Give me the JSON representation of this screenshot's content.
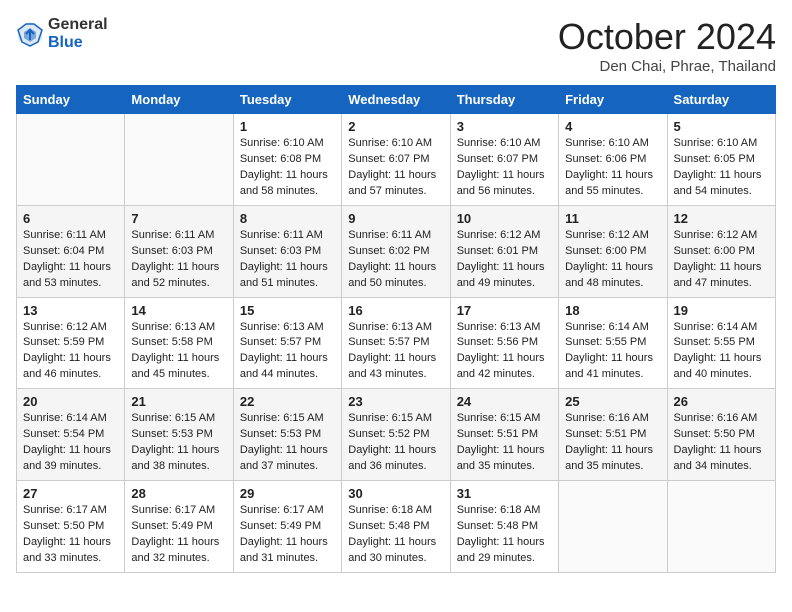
{
  "header": {
    "logo_general": "General",
    "logo_blue": "Blue",
    "month_title": "October 2024",
    "location": "Den Chai, Phrae, Thailand"
  },
  "weekdays": [
    "Sunday",
    "Monday",
    "Tuesday",
    "Wednesday",
    "Thursday",
    "Friday",
    "Saturday"
  ],
  "weeks": [
    [
      {
        "day": "",
        "sunrise": "",
        "sunset": "",
        "daylight": ""
      },
      {
        "day": "",
        "sunrise": "",
        "sunset": "",
        "daylight": ""
      },
      {
        "day": "1",
        "sunrise": "Sunrise: 6:10 AM",
        "sunset": "Sunset: 6:08 PM",
        "daylight": "Daylight: 11 hours and 58 minutes."
      },
      {
        "day": "2",
        "sunrise": "Sunrise: 6:10 AM",
        "sunset": "Sunset: 6:07 PM",
        "daylight": "Daylight: 11 hours and 57 minutes."
      },
      {
        "day": "3",
        "sunrise": "Sunrise: 6:10 AM",
        "sunset": "Sunset: 6:07 PM",
        "daylight": "Daylight: 11 hours and 56 minutes."
      },
      {
        "day": "4",
        "sunrise": "Sunrise: 6:10 AM",
        "sunset": "Sunset: 6:06 PM",
        "daylight": "Daylight: 11 hours and 55 minutes."
      },
      {
        "day": "5",
        "sunrise": "Sunrise: 6:10 AM",
        "sunset": "Sunset: 6:05 PM",
        "daylight": "Daylight: 11 hours and 54 minutes."
      }
    ],
    [
      {
        "day": "6",
        "sunrise": "Sunrise: 6:11 AM",
        "sunset": "Sunset: 6:04 PM",
        "daylight": "Daylight: 11 hours and 53 minutes."
      },
      {
        "day": "7",
        "sunrise": "Sunrise: 6:11 AM",
        "sunset": "Sunset: 6:03 PM",
        "daylight": "Daylight: 11 hours and 52 minutes."
      },
      {
        "day": "8",
        "sunrise": "Sunrise: 6:11 AM",
        "sunset": "Sunset: 6:03 PM",
        "daylight": "Daylight: 11 hours and 51 minutes."
      },
      {
        "day": "9",
        "sunrise": "Sunrise: 6:11 AM",
        "sunset": "Sunset: 6:02 PM",
        "daylight": "Daylight: 11 hours and 50 minutes."
      },
      {
        "day": "10",
        "sunrise": "Sunrise: 6:12 AM",
        "sunset": "Sunset: 6:01 PM",
        "daylight": "Daylight: 11 hours and 49 minutes."
      },
      {
        "day": "11",
        "sunrise": "Sunrise: 6:12 AM",
        "sunset": "Sunset: 6:00 PM",
        "daylight": "Daylight: 11 hours and 48 minutes."
      },
      {
        "day": "12",
        "sunrise": "Sunrise: 6:12 AM",
        "sunset": "Sunset: 6:00 PM",
        "daylight": "Daylight: 11 hours and 47 minutes."
      }
    ],
    [
      {
        "day": "13",
        "sunrise": "Sunrise: 6:12 AM",
        "sunset": "Sunset: 5:59 PM",
        "daylight": "Daylight: 11 hours and 46 minutes."
      },
      {
        "day": "14",
        "sunrise": "Sunrise: 6:13 AM",
        "sunset": "Sunset: 5:58 PM",
        "daylight": "Daylight: 11 hours and 45 minutes."
      },
      {
        "day": "15",
        "sunrise": "Sunrise: 6:13 AM",
        "sunset": "Sunset: 5:57 PM",
        "daylight": "Daylight: 11 hours and 44 minutes."
      },
      {
        "day": "16",
        "sunrise": "Sunrise: 6:13 AM",
        "sunset": "Sunset: 5:57 PM",
        "daylight": "Daylight: 11 hours and 43 minutes."
      },
      {
        "day": "17",
        "sunrise": "Sunrise: 6:13 AM",
        "sunset": "Sunset: 5:56 PM",
        "daylight": "Daylight: 11 hours and 42 minutes."
      },
      {
        "day": "18",
        "sunrise": "Sunrise: 6:14 AM",
        "sunset": "Sunset: 5:55 PM",
        "daylight": "Daylight: 11 hours and 41 minutes."
      },
      {
        "day": "19",
        "sunrise": "Sunrise: 6:14 AM",
        "sunset": "Sunset: 5:55 PM",
        "daylight": "Daylight: 11 hours and 40 minutes."
      }
    ],
    [
      {
        "day": "20",
        "sunrise": "Sunrise: 6:14 AM",
        "sunset": "Sunset: 5:54 PM",
        "daylight": "Daylight: 11 hours and 39 minutes."
      },
      {
        "day": "21",
        "sunrise": "Sunrise: 6:15 AM",
        "sunset": "Sunset: 5:53 PM",
        "daylight": "Daylight: 11 hours and 38 minutes."
      },
      {
        "day": "22",
        "sunrise": "Sunrise: 6:15 AM",
        "sunset": "Sunset: 5:53 PM",
        "daylight": "Daylight: 11 hours and 37 minutes."
      },
      {
        "day": "23",
        "sunrise": "Sunrise: 6:15 AM",
        "sunset": "Sunset: 5:52 PM",
        "daylight": "Daylight: 11 hours and 36 minutes."
      },
      {
        "day": "24",
        "sunrise": "Sunrise: 6:15 AM",
        "sunset": "Sunset: 5:51 PM",
        "daylight": "Daylight: 11 hours and 35 minutes."
      },
      {
        "day": "25",
        "sunrise": "Sunrise: 6:16 AM",
        "sunset": "Sunset: 5:51 PM",
        "daylight": "Daylight: 11 hours and 35 minutes."
      },
      {
        "day": "26",
        "sunrise": "Sunrise: 6:16 AM",
        "sunset": "Sunset: 5:50 PM",
        "daylight": "Daylight: 11 hours and 34 minutes."
      }
    ],
    [
      {
        "day": "27",
        "sunrise": "Sunrise: 6:17 AM",
        "sunset": "Sunset: 5:50 PM",
        "daylight": "Daylight: 11 hours and 33 minutes."
      },
      {
        "day": "28",
        "sunrise": "Sunrise: 6:17 AM",
        "sunset": "Sunset: 5:49 PM",
        "daylight": "Daylight: 11 hours and 32 minutes."
      },
      {
        "day": "29",
        "sunrise": "Sunrise: 6:17 AM",
        "sunset": "Sunset: 5:49 PM",
        "daylight": "Daylight: 11 hours and 31 minutes."
      },
      {
        "day": "30",
        "sunrise": "Sunrise: 6:18 AM",
        "sunset": "Sunset: 5:48 PM",
        "daylight": "Daylight: 11 hours and 30 minutes."
      },
      {
        "day": "31",
        "sunrise": "Sunrise: 6:18 AM",
        "sunset": "Sunset: 5:48 PM",
        "daylight": "Daylight: 11 hours and 29 minutes."
      },
      {
        "day": "",
        "sunrise": "",
        "sunset": "",
        "daylight": ""
      },
      {
        "day": "",
        "sunrise": "",
        "sunset": "",
        "daylight": ""
      }
    ]
  ]
}
